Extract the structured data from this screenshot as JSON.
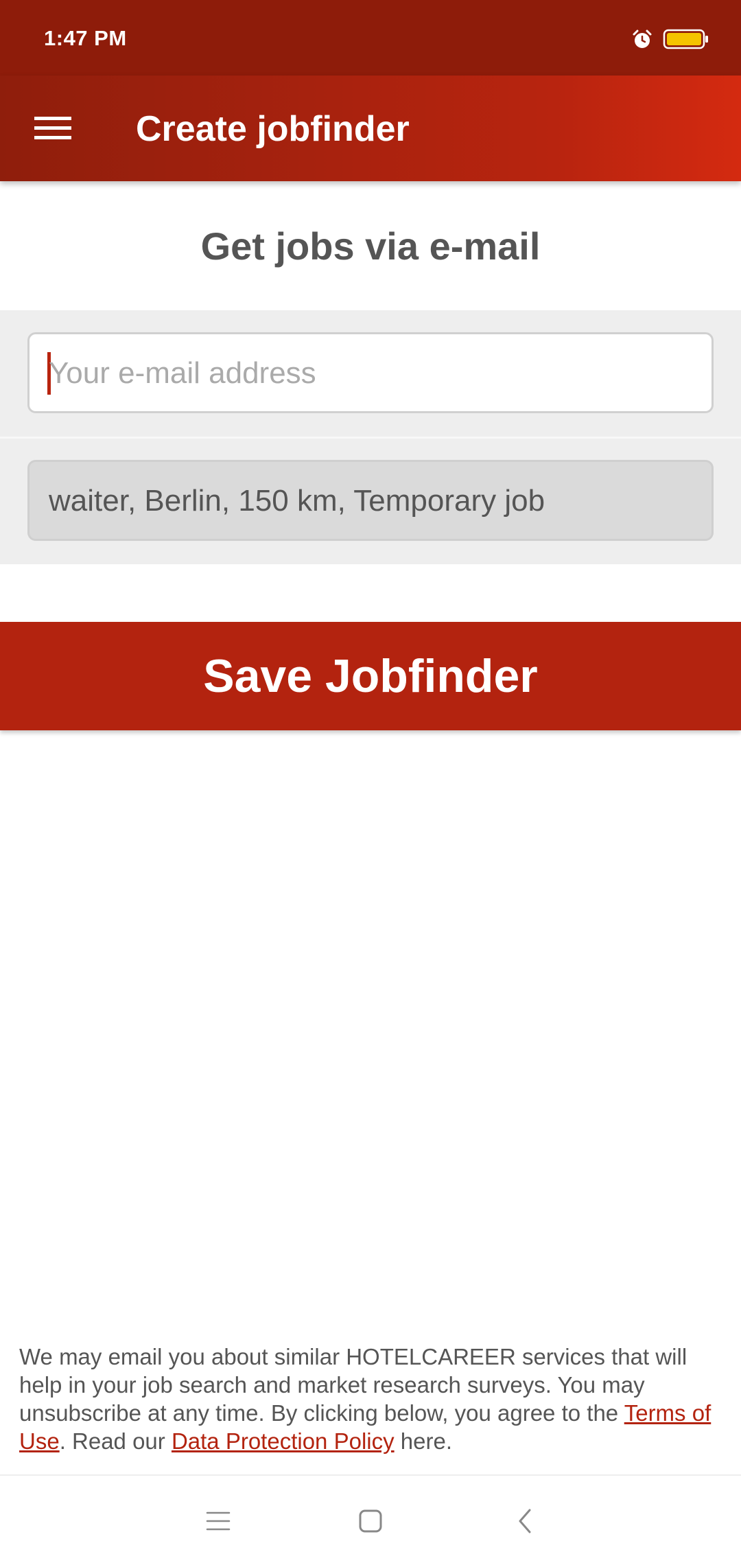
{
  "status_bar": {
    "time": "1:47 PM",
    "icons": [
      "alarm-icon",
      "battery-icon"
    ],
    "battery_color": "#f5c400"
  },
  "app_bar": {
    "title": "Create jobfinder",
    "menu_icon": "menu-icon"
  },
  "page": {
    "heading": "Get jobs via e-mail"
  },
  "form": {
    "email_placeholder": "Your e-mail address",
    "email_value": "",
    "search_summary": "waiter, Berlin, 150 km, Temporary job",
    "save_label": "Save Jobfinder"
  },
  "footer": {
    "text_before_terms": "We may email you about similar HOTELCAREER services that will help in your job search and market research surveys. You may unsubscribe at any time. By clicking below, you agree to the ",
    "terms_link": "Terms of Use",
    "text_between": ". Read our ",
    "privacy_link": "Data Protection Policy",
    "text_after": " here."
  },
  "nav_bar": {
    "icons": [
      "recent-apps-icon",
      "home-icon",
      "back-icon"
    ]
  },
  "colors": {
    "brand": "#b3230f",
    "status_bar": "#8e1c0a"
  }
}
